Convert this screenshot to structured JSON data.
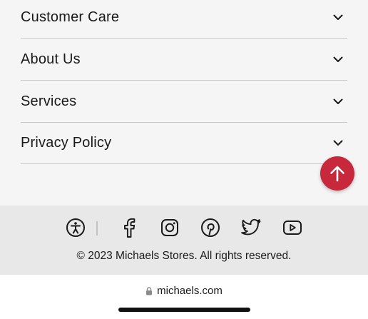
{
  "accordion": {
    "items": [
      {
        "label": "Customer Care"
      },
      {
        "label": "About Us"
      },
      {
        "label": "Services"
      },
      {
        "label": "Privacy Policy"
      }
    ]
  },
  "back_to_top": {
    "icon": "arrow-up-icon"
  },
  "footer": {
    "social_icons": [
      "accessibility-icon",
      "facebook-icon",
      "instagram-icon",
      "pinterest-icon",
      "twitter-icon",
      "youtube-icon"
    ],
    "copyright": "© 2023 Michaels Stores. All rights reserved."
  },
  "browser": {
    "url": "michaels.com"
  },
  "colors": {
    "accent": "#c8283c",
    "footer_bg": "#e8e8e8",
    "page_bg": "#f5f5f5"
  }
}
